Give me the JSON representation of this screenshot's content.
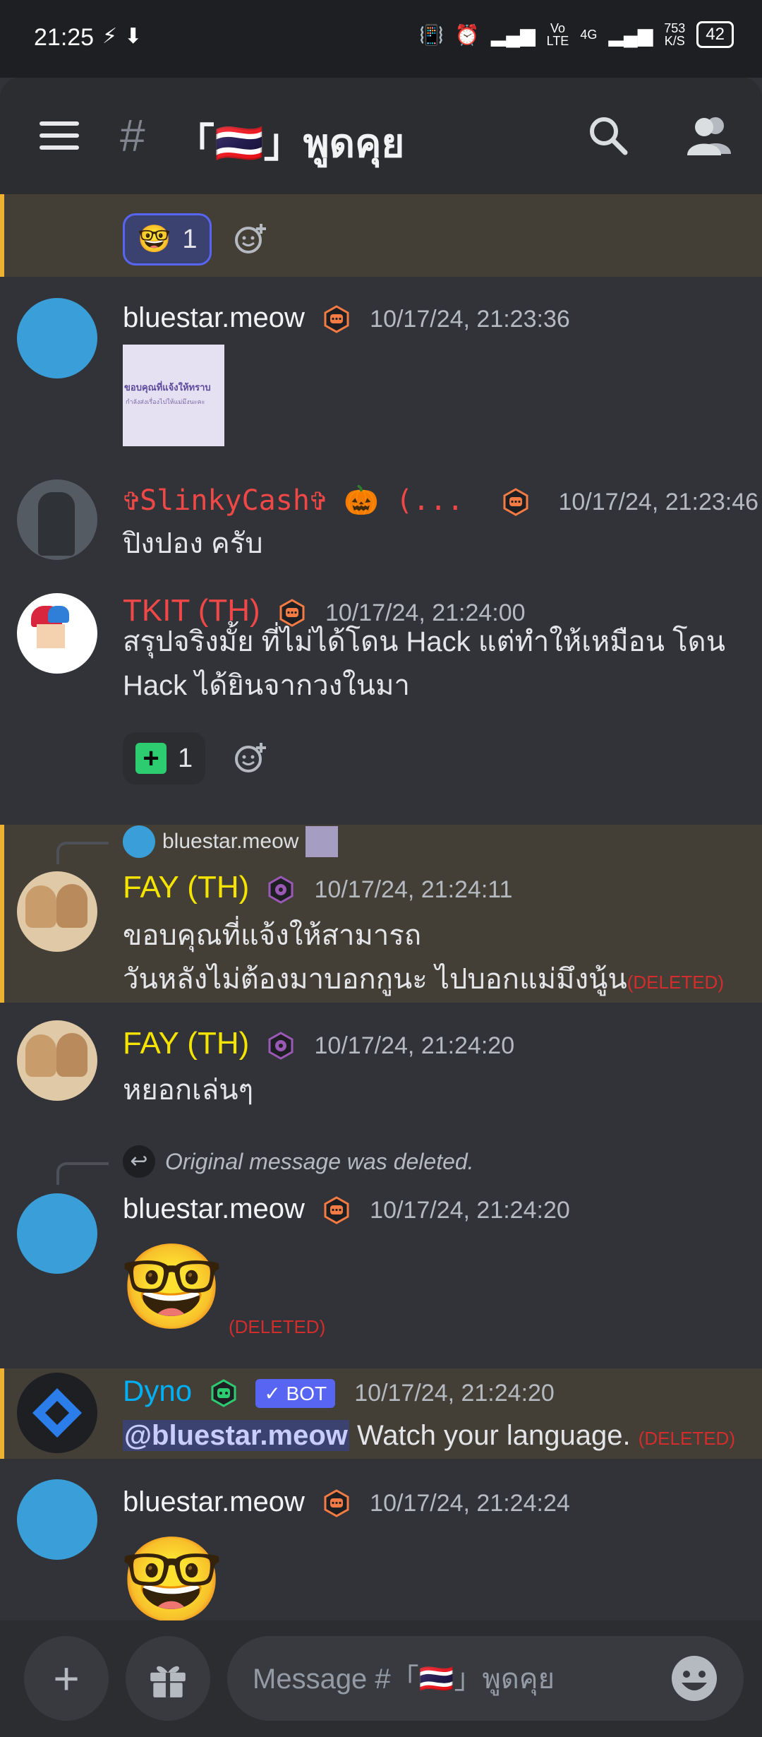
{
  "status_bar": {
    "time": "21:25",
    "left_icons": [
      "activity-icon",
      "download-icon"
    ],
    "net_top": "Vo",
    "net_bottom": "LTE",
    "net4g": "4G",
    "speed_top": "753",
    "speed_bottom": "K/S",
    "battery": "42"
  },
  "header": {
    "hash": "#",
    "channel_name": "「🇹🇭」พูดคุย"
  },
  "colors": {
    "background": "#313338",
    "highlight": "#433f37",
    "highlight_bar": "#f0b132",
    "blurple": "#5865f2",
    "name_red": "#f04747",
    "name_yellow": "#f5e400",
    "name_dyno": "#00b0f4",
    "role_orange": "#f47b43",
    "role_purple": "#9b59b6"
  },
  "messages": [
    {
      "reaction_emoji": "🤓",
      "reaction_count": "1"
    },
    {
      "author": "bluestar.meow",
      "timestamp": "10/17/24, 21:23:36",
      "image_text_line1": "ขอบคุณที่แจ้งให้ทราบ",
      "image_text_line2": "กำลังส่งเรื่องไปให้แม่มึงนะคะ"
    },
    {
      "author": "✞SlinkyCash✞ 🎃 (...",
      "timestamp": "10/17/24, 21:23:46",
      "text": "ปิงปอง ครับ"
    },
    {
      "author": "TKIT (TH)",
      "timestamp": "10/17/24, 21:24:00",
      "text": "สรุปจริงมั้ย ที่ไม่ได้โดน Hack แต่ทำให้เหมือน โดน Hack ได้ยินจากวงในมา",
      "reaction_emoji": "➕",
      "reaction_count": "1"
    },
    {
      "reply_to": "bluestar.meow",
      "author": "FAY (TH)",
      "timestamp": "10/17/24, 21:24:11",
      "line1": "ขอบคุณที่แจ้งให้สามารถ",
      "line2": "วันหลังไม่ต้องมาบอกกูนะ ไปบอกแม่มึงนู้น",
      "deleted_tag": "(DELETED)"
    },
    {
      "author": "FAY (TH)",
      "timestamp": "10/17/24, 21:24:20",
      "text": "หยอกเล่นๆ"
    },
    {
      "reply_note": "Original message was deleted.",
      "author": "bluestar.meow",
      "timestamp": "10/17/24, 21:24:20",
      "emoji": "🤓",
      "deleted_tag": "(DELETED)"
    },
    {
      "author": "Dyno",
      "bot_tag": "✓ BOT",
      "timestamp": "10/17/24, 21:24:20",
      "mention": "@bluestar.meow",
      "text": " Watch your language. ",
      "deleted_tag": "(DELETED)"
    },
    {
      "author": "bluestar.meow",
      "timestamp": "10/17/24, 21:24:24",
      "emoji": "🤓"
    }
  ],
  "composer": {
    "placeholder": "Message #「🇹🇭」พูดคุย",
    "plus": "+"
  }
}
